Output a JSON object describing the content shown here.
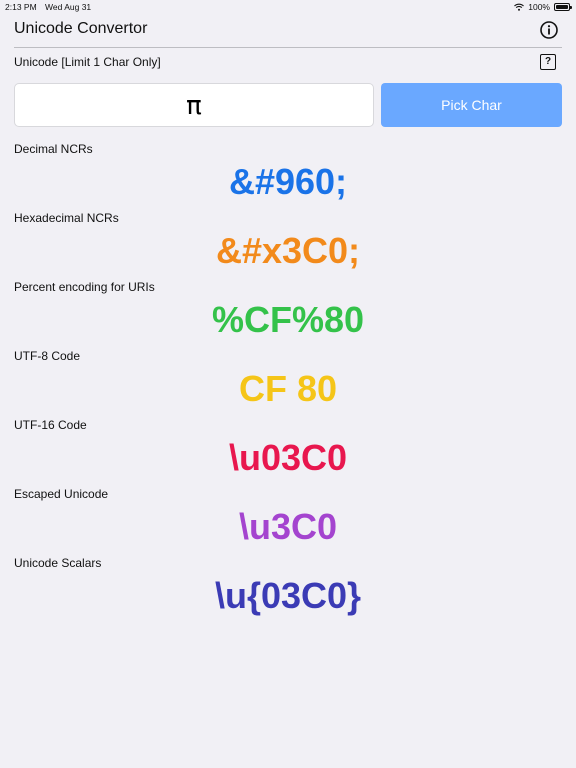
{
  "status": {
    "time": "2:13 PM",
    "date": "Wed Aug 31",
    "battery": "100%",
    "battery_level": 1.0
  },
  "header": {
    "title": "Unicode Convertor",
    "info_icon": "info-circle-icon"
  },
  "input": {
    "label": "Unicode [Limit 1 Char Only]",
    "help_icon": "question-square-icon",
    "help_glyph": "?",
    "value": "π",
    "pick_button": "Pick Char"
  },
  "results": [
    {
      "label": "Decimal NCRs",
      "value": "&#960;",
      "color": "#1a73e8"
    },
    {
      "label": "Hexadecimal NCRs",
      "value": "&#x3C0;",
      "color": "#f28a1b"
    },
    {
      "label": "Percent encoding for URIs",
      "value": "%CF%80",
      "color": "#34c24a"
    },
    {
      "label": "UTF-8 Code",
      "value": "CF 80",
      "color": "#f5c518"
    },
    {
      "label": "UTF-16 Code",
      "value": "\\u03C0",
      "color": "#e8174e"
    },
    {
      "label": "Escaped Unicode",
      "value": "\\u3C0",
      "color": "#a444cf"
    },
    {
      "label": "Unicode Scalars",
      "value": "\\u{03C0}",
      "color": "#3b3bb5"
    }
  ]
}
